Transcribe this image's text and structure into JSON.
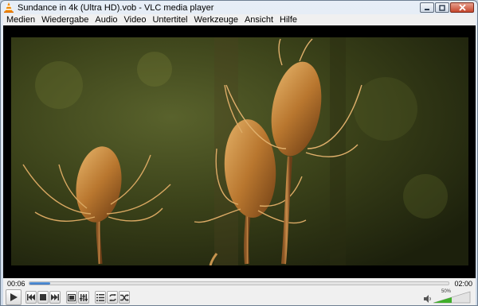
{
  "window": {
    "title": "Sundance in 4k (Ultra HD).vob - VLC media player"
  },
  "menu": {
    "items": [
      "Medien",
      "Wiedergabe",
      "Audio",
      "Video",
      "Untertitel",
      "Werkzeuge",
      "Ansicht",
      "Hilfe"
    ]
  },
  "player": {
    "elapsed": "00:06",
    "total": "02:00",
    "progress": 0.05,
    "volume_label": "50%",
    "volume": 0.5
  },
  "icons": {
    "app": "vlc-cone-icon",
    "play": "play-icon",
    "previous": "previous-icon",
    "stop": "stop-icon",
    "next": "next-icon",
    "fullscreen": "fullscreen-icon",
    "extended": "equalizer-icon",
    "playlist": "playlist-icon",
    "loop": "loop-icon",
    "shuffle": "shuffle-icon",
    "volume": "speaker-icon"
  },
  "colors": {
    "accent": "#2f6fc1",
    "volume_fill": "#3fae2a",
    "vlc_orange": "#f08a00"
  }
}
